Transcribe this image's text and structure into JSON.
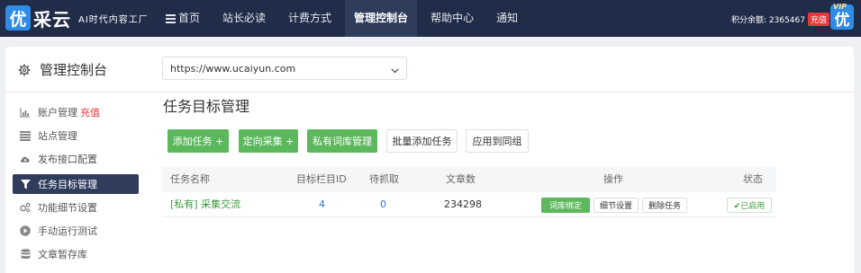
{
  "header": {
    "logo_badge": "优",
    "logo_text": "采云",
    "slogan": "AI时代内容工厂",
    "nav": [
      {
        "label": "首页",
        "icon": "menu-icon"
      },
      {
        "label": "站长必读"
      },
      {
        "label": "计费方式"
      },
      {
        "label": "管理控制台",
        "active": true
      },
      {
        "label": "帮助中心"
      },
      {
        "label": "通知"
      }
    ],
    "points_label": "积分余额: 2365467",
    "recharge_label": "充值",
    "vip_badge": "优",
    "vip_tag": "VIP"
  },
  "page": {
    "title": "管理控制台",
    "icon": "gear-icon"
  },
  "sidebar": {
    "items": [
      {
        "label": "账户管理",
        "extra": "充值",
        "icon": "bar-chart-icon"
      },
      {
        "label": "站点管理",
        "icon": "list-icon"
      },
      {
        "label": "发布接口配置",
        "icon": "cloud-upload-icon"
      },
      {
        "label": "任务目标管理",
        "icon": "filter-icon",
        "active": true
      },
      {
        "label": "功能细节设置",
        "icon": "gears-icon"
      },
      {
        "label": "手动运行测试",
        "icon": "play-circle-icon"
      },
      {
        "label": "文章暂存库",
        "icon": "database-icon"
      }
    ]
  },
  "main": {
    "site_select": {
      "value": "https://www.ucaiyun.com"
    },
    "section_title": "任务目标管理",
    "buttons": [
      {
        "label": "添加任务 +",
        "style": "green"
      },
      {
        "label": "定向采集 +",
        "style": "green"
      },
      {
        "label": "私有词库管理",
        "style": "green"
      },
      {
        "label": "批量添加任务",
        "style": "white"
      },
      {
        "label": "应用到同组",
        "style": "white"
      }
    ],
    "table": {
      "headers": [
        "任务名称",
        "目标栏目ID",
        "待抓取",
        "文章数",
        "操作",
        "状态"
      ],
      "rows": [
        {
          "name": "[私有] 采集交流",
          "column_id": "4",
          "pending": "0",
          "articles": "234298",
          "actions": [
            "词库绑定",
            "细节设置",
            "删除任务"
          ],
          "status": "✔已启用"
        }
      ]
    }
  },
  "colors": {
    "nav_bg": "#202c48",
    "accent_green": "#5cb85c",
    "brand_blue": "#2e8be6",
    "danger_red": "#e4393c"
  }
}
